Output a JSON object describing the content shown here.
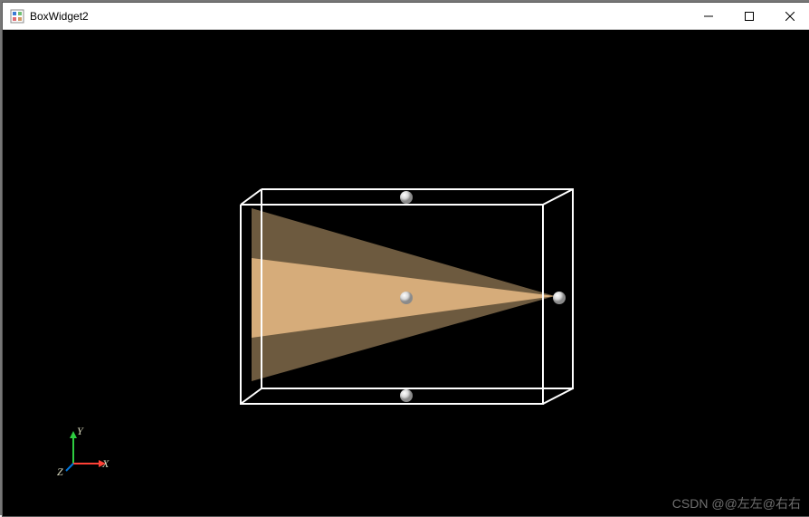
{
  "window": {
    "title": "BoxWidget2"
  },
  "axes": {
    "x": "X",
    "y": "Y",
    "z": "Z"
  },
  "watermark": "CSDN @@左左@右右"
}
